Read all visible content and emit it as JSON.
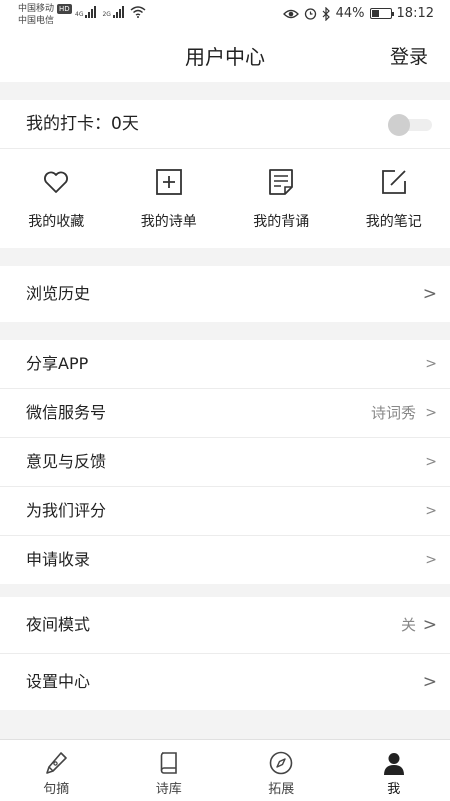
{
  "status_bar": {
    "carrier1": "中国移动",
    "carrier1_badge": "HD",
    "carrier2": "中国电信",
    "net1": "4G",
    "net2": "2G",
    "battery_percent": "44%",
    "battery_level": 0.44,
    "time": "18:12"
  },
  "header": {
    "title": "用户中心",
    "login": "登录"
  },
  "checkin": {
    "label": "我的打卡：0天",
    "toggle_on": false
  },
  "quick_actions": [
    {
      "label": "我的收藏",
      "icon": "heart-icon"
    },
    {
      "label": "我的诗单",
      "icon": "plus-square-icon"
    },
    {
      "label": "我的背诵",
      "icon": "document-icon"
    },
    {
      "label": "我的笔记",
      "icon": "edit-icon"
    }
  ],
  "history": {
    "label": "浏览历史",
    "chevron": ">"
  },
  "menu": [
    {
      "label": "分享APP",
      "value": "",
      "chevron": ">"
    },
    {
      "label": "微信服务号",
      "value": "诗词秀",
      "chevron": ">"
    },
    {
      "label": "意见与反馈",
      "value": "",
      "chevron": ">"
    },
    {
      "label": "为我们评分",
      "value": "",
      "chevron": ">"
    },
    {
      "label": "申请收录",
      "value": "",
      "chevron": ">"
    }
  ],
  "settings": [
    {
      "label": "夜间模式",
      "value": "关",
      "chevron": ">"
    },
    {
      "label": "设置中心",
      "value": "",
      "chevron": ">"
    }
  ],
  "tabs": [
    {
      "label": "句摘",
      "icon": "pen-icon"
    },
    {
      "label": "诗库",
      "icon": "book-icon"
    },
    {
      "label": "拓展",
      "icon": "compass-icon"
    },
    {
      "label": "我",
      "icon": "user-icon",
      "active": true
    }
  ],
  "colors": {
    "text": "#222222",
    "muted": "#888888",
    "background": "#f3f3f3",
    "divider": "#ececec"
  }
}
